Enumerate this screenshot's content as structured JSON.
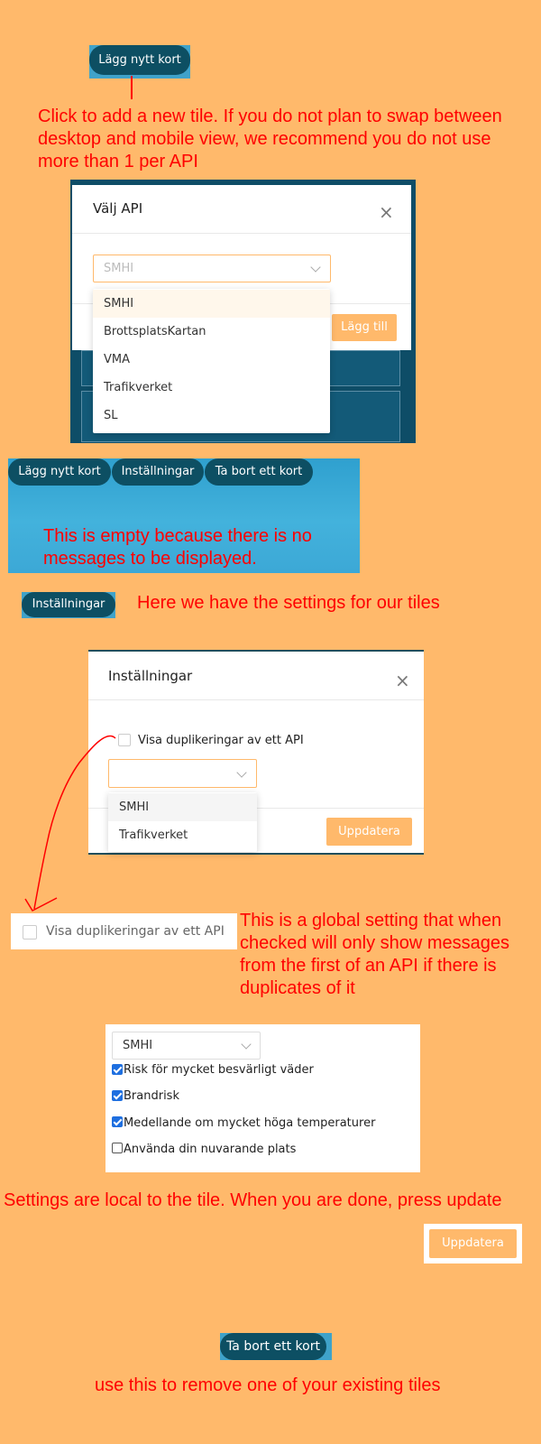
{
  "buttons": {
    "add_card": "Lägg nytt kort",
    "settings": "Inställningar",
    "remove_card": "Ta bort ett kort"
  },
  "annotations": {
    "add_tile": "Click to add a new tile. If you do not plan to swap between desktop and mobile view, we recommend you do not use more than 1 per API",
    "empty": "This is empty because there is no messages to be displayed.",
    "settings_intro": "Here we have the settings for our tiles",
    "global_setting": "This is a global setting that when checked will only show messages from the first of an API if there is duplicates of it",
    "local_settings": "Settings are local to the tile. When you are done, press update",
    "remove_tile": "use this to remove one of your existing tiles"
  },
  "api_modal": {
    "title": "Välj API",
    "close": "×",
    "selected": "SMHI",
    "options": [
      "SMHI",
      "BrottsplatsKartan",
      "VMA",
      "Trafikverket",
      "SL"
    ],
    "add_button": "Lägg till"
  },
  "settings_modal": {
    "title": "Inställningar",
    "close": "×",
    "duplicate_label": "Visa duplikeringar av ett API",
    "options": [
      "SMHI",
      "Trafikverket"
    ],
    "update_button": "Uppdatera"
  },
  "global_checkbox": {
    "label": "Visa duplikeringar av ett API",
    "checked": false
  },
  "tile_settings": {
    "selected": "SMHI",
    "checks": [
      {
        "label": "Risk för mycket besvärligt väder",
        "checked": true
      },
      {
        "label": "Brandrisk",
        "checked": true
      },
      {
        "label": "Medellande om mycket höga temperaturer",
        "checked": true
      },
      {
        "label": "Använda din nuvarande plats",
        "checked": false
      }
    ],
    "update_button": "Uppdatera"
  },
  "colors": {
    "background": "#FFB96B",
    "button": "#0D4F63",
    "annotation": "#FF0000",
    "accent": "#FFB96B"
  }
}
